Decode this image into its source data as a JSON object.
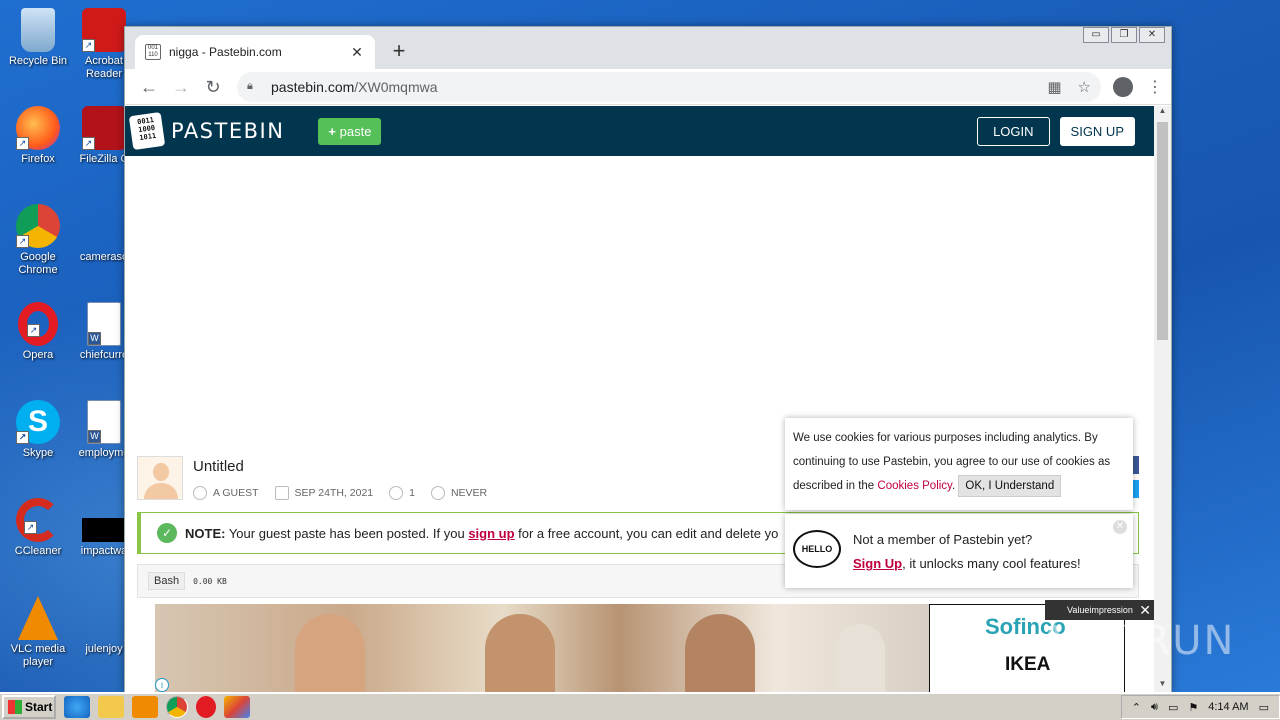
{
  "desktop": {
    "icons": [
      {
        "label": "Recycle Bin",
        "icon": "recycle-bin-icon"
      },
      {
        "label": "Acrobat Reader",
        "icon": "acrobat-icon"
      },
      {
        "label": "Firefox",
        "icon": "firefox-icon"
      },
      {
        "label": "FileZilla C",
        "icon": "filezilla-icon"
      },
      {
        "label": "Google Chrome",
        "icon": "chrome-icon"
      },
      {
        "label": "cameraso",
        "icon": "file-icon"
      },
      {
        "label": "Opera",
        "icon": "opera-icon"
      },
      {
        "label": "chiefcurre",
        "icon": "word-doc-icon"
      },
      {
        "label": "Skype",
        "icon": "skype-icon"
      },
      {
        "label": "employme",
        "icon": "word-doc-icon"
      },
      {
        "label": "CCleaner",
        "icon": "ccleaner-icon"
      },
      {
        "label": "impactwa",
        "icon": "black-file-icon"
      },
      {
        "label": "VLC media player",
        "icon": "vlc-icon"
      },
      {
        "label": "julenjoy",
        "icon": "file-icon"
      }
    ],
    "watermark": "ANY RUN"
  },
  "browser": {
    "tab_title": "nigga - Pastebin.com",
    "url_host": "pastebin.com",
    "url_path": "/XW0mqmwa"
  },
  "pastebin": {
    "logo_text": "PASTEBIN",
    "logo_bits": "0011 1000 1011",
    "paste_button": "paste",
    "login": "LOGIN",
    "signup": "SIGN UP",
    "paste_title": "Untitled",
    "meta": {
      "author": "A GUEST",
      "date": "SEP 24TH, 2021",
      "views": "1",
      "expires": "NEVER"
    },
    "notice": {
      "bold": "NOTE:",
      "text_before": " Your guest paste has been posted. If you ",
      "link": "sign up",
      "text_after": " for a free account, you can edit and delete yo"
    },
    "code": {
      "language": "Bash",
      "size": "0.00 KB"
    },
    "cookie": {
      "text": "We use cookies for various purposes including analytics. By continuing to use Pastebin, you agree to our use of cookies as described in the ",
      "link": "Cookies Policy",
      "end": ".",
      "ok": "OK, I Understand"
    },
    "hello": {
      "bubble": "HELLO",
      "line1": "Not a member of Pastebin yet?",
      "link": "Sign Up",
      "line2": ", it unlocks many cool features!"
    },
    "ad": {
      "brand1": "Sofinco",
      "brand2": "IKEA",
      "provider": "Valueimpression"
    }
  },
  "taskbar": {
    "start": "Start",
    "clock": "4:14 AM"
  }
}
